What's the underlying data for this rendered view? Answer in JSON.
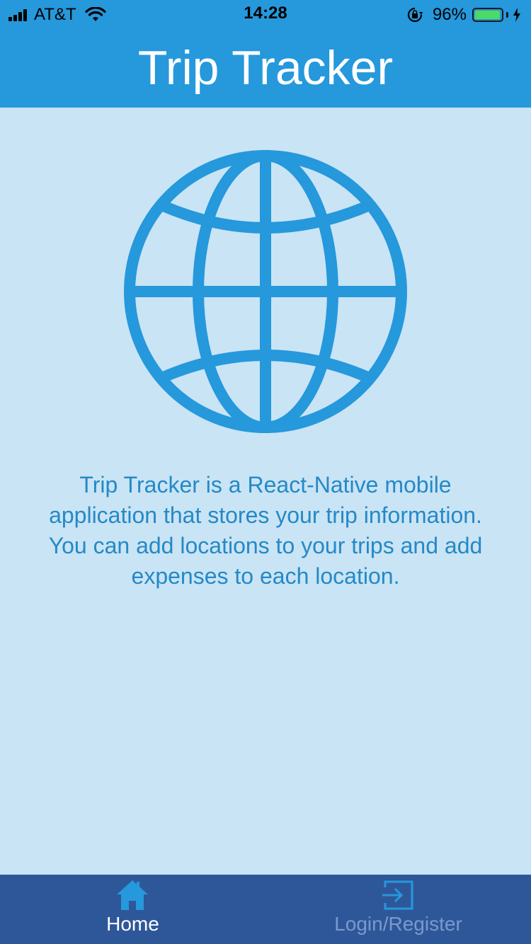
{
  "status_bar": {
    "carrier": "AT&T",
    "time": "14:28",
    "battery_percent": "96%",
    "battery_level": 0.96,
    "icons": [
      "signal-icon",
      "wifi-icon",
      "orientation-lock-icon",
      "battery-icon",
      "charging-bolt-icon"
    ]
  },
  "header": {
    "title": "Trip Tracker"
  },
  "main": {
    "hero_icon": "globe-icon",
    "description": "Trip Tracker is a React-Native mobile application that stores your trip information. You can add locations to your trips and add expenses to each location."
  },
  "tab_bar": {
    "tabs": [
      {
        "label": "Home",
        "icon": "home-icon",
        "active": true
      },
      {
        "label": "Login/Register",
        "icon": "login-icon",
        "active": false
      }
    ]
  },
  "colors": {
    "header_bg": "#2698dc",
    "page_bg": "#c9e4f4",
    "accent": "#2698dc",
    "description_text": "#2589c7",
    "tab_bar_bg": "#2e579a",
    "tab_active_label": "#ffffff",
    "tab_inactive": "#7a9acb",
    "battery_fill": "#4cd964"
  }
}
